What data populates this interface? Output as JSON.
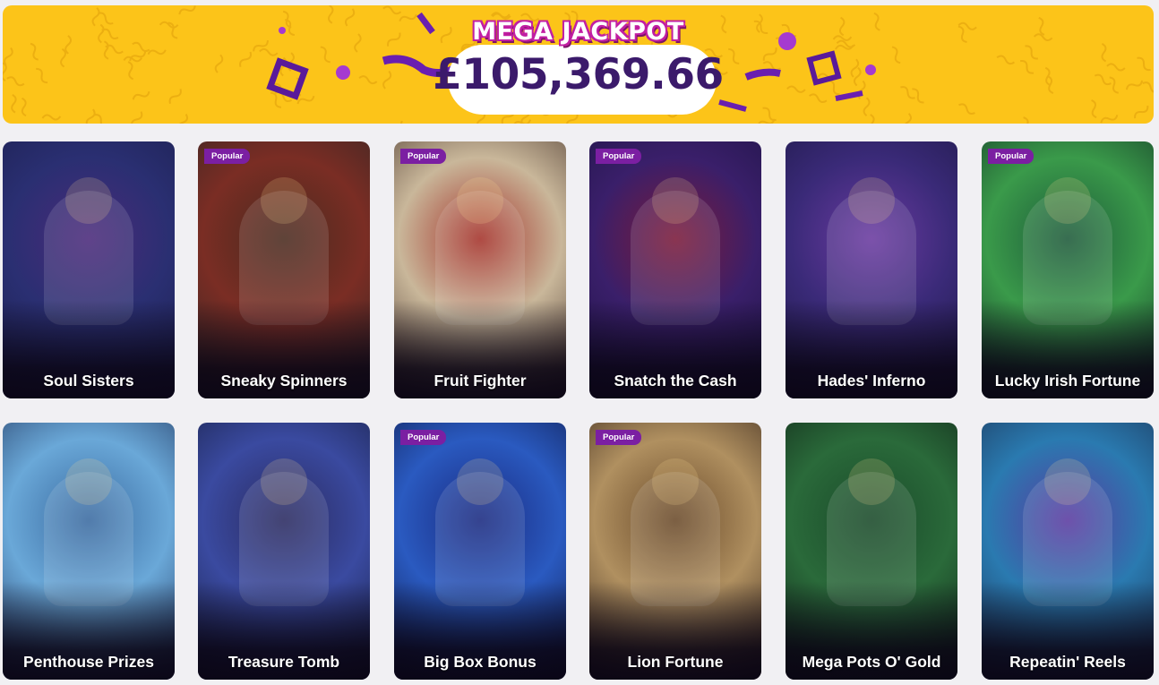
{
  "jackpot": {
    "title": "MEGA JACKPOT",
    "amount": "£105,369.66"
  },
  "badge_label": "Popular",
  "games": [
    {
      "name": "Soul Sisters",
      "popular": false,
      "colors": [
        "#2a2f72",
        "#4a2a7a",
        "#1a1d4a"
      ]
    },
    {
      "name": "Sneaky Spinners",
      "popular": true,
      "colors": [
        "#7a2d24",
        "#4a2b1e",
        "#2a2424"
      ]
    },
    {
      "name": "Fruit Fighter",
      "popular": true,
      "colors": [
        "#c9b79a",
        "#a4322a",
        "#3a2620"
      ]
    },
    {
      "name": "Snatch the Cash",
      "popular": true,
      "colors": [
        "#3a1f6a",
        "#7a1a3a",
        "#1a1240"
      ]
    },
    {
      "name": "Hades' Inferno",
      "popular": false,
      "colors": [
        "#3a2a78",
        "#6a3aa0",
        "#1a1640"
      ]
    },
    {
      "name": "Lucky Irish Fortune",
      "popular": true,
      "colors": [
        "#3a9a4a",
        "#1d5a3a",
        "#0f2a22"
      ]
    },
    {
      "name": "Penthouse Prizes",
      "popular": false,
      "colors": [
        "#6aa8d8",
        "#3a6aa0",
        "#1a2a52"
      ]
    },
    {
      "name": "Treasure Tomb",
      "popular": false,
      "colors": [
        "#3a4aa0",
        "#2a2a60",
        "#141a3a"
      ]
    },
    {
      "name": "Big Box Bonus",
      "popular": true,
      "colors": [
        "#2a5ac0",
        "#1a2a80",
        "#0c1440"
      ]
    },
    {
      "name": "Lion Fortune",
      "popular": true,
      "colors": [
        "#b09060",
        "#6a4a2a",
        "#2a1a14"
      ]
    },
    {
      "name": "Mega Pots O' Gold",
      "popular": false,
      "colors": [
        "#2a6a3a",
        "#1a4a2a",
        "#0e1e14"
      ]
    },
    {
      "name": "Repeatin' Reels",
      "popular": false,
      "colors": [
        "#2a7ab0",
        "#5a3aa0",
        "#1a2a4a"
      ]
    }
  ]
}
